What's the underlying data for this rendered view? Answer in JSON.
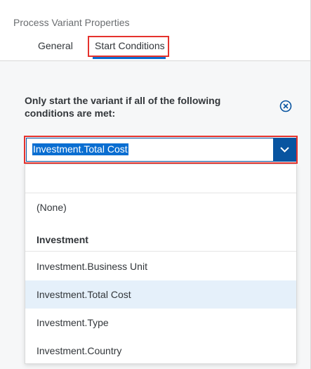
{
  "panel": {
    "title": "Process Variant Properties",
    "tabs": [
      {
        "label": "General",
        "selected": false
      },
      {
        "label": "Start Conditions",
        "selected": true
      }
    ]
  },
  "conditions": {
    "label": "Only start the variant if all of the following conditions are met:",
    "remove_icon": "remove-circle-icon"
  },
  "combo": {
    "value": "Investment.Total Cost",
    "button_icon": "chevron-down-icon"
  },
  "dropdown": {
    "items": [
      {
        "label": "(None)",
        "type": "item"
      },
      {
        "label": "Investment",
        "type": "group"
      },
      {
        "label": "Investment.Business Unit",
        "type": "item"
      },
      {
        "label": "Investment.Total Cost",
        "type": "item",
        "selected": true
      },
      {
        "label": "Investment.Type",
        "type": "item"
      },
      {
        "label": "Investment.Country",
        "type": "item"
      }
    ]
  },
  "colors": {
    "accent": "#0a6ed1",
    "combo_button": "#0854a0",
    "highlight_outline": "#e5322d",
    "selected_row": "#e5f0fa"
  }
}
